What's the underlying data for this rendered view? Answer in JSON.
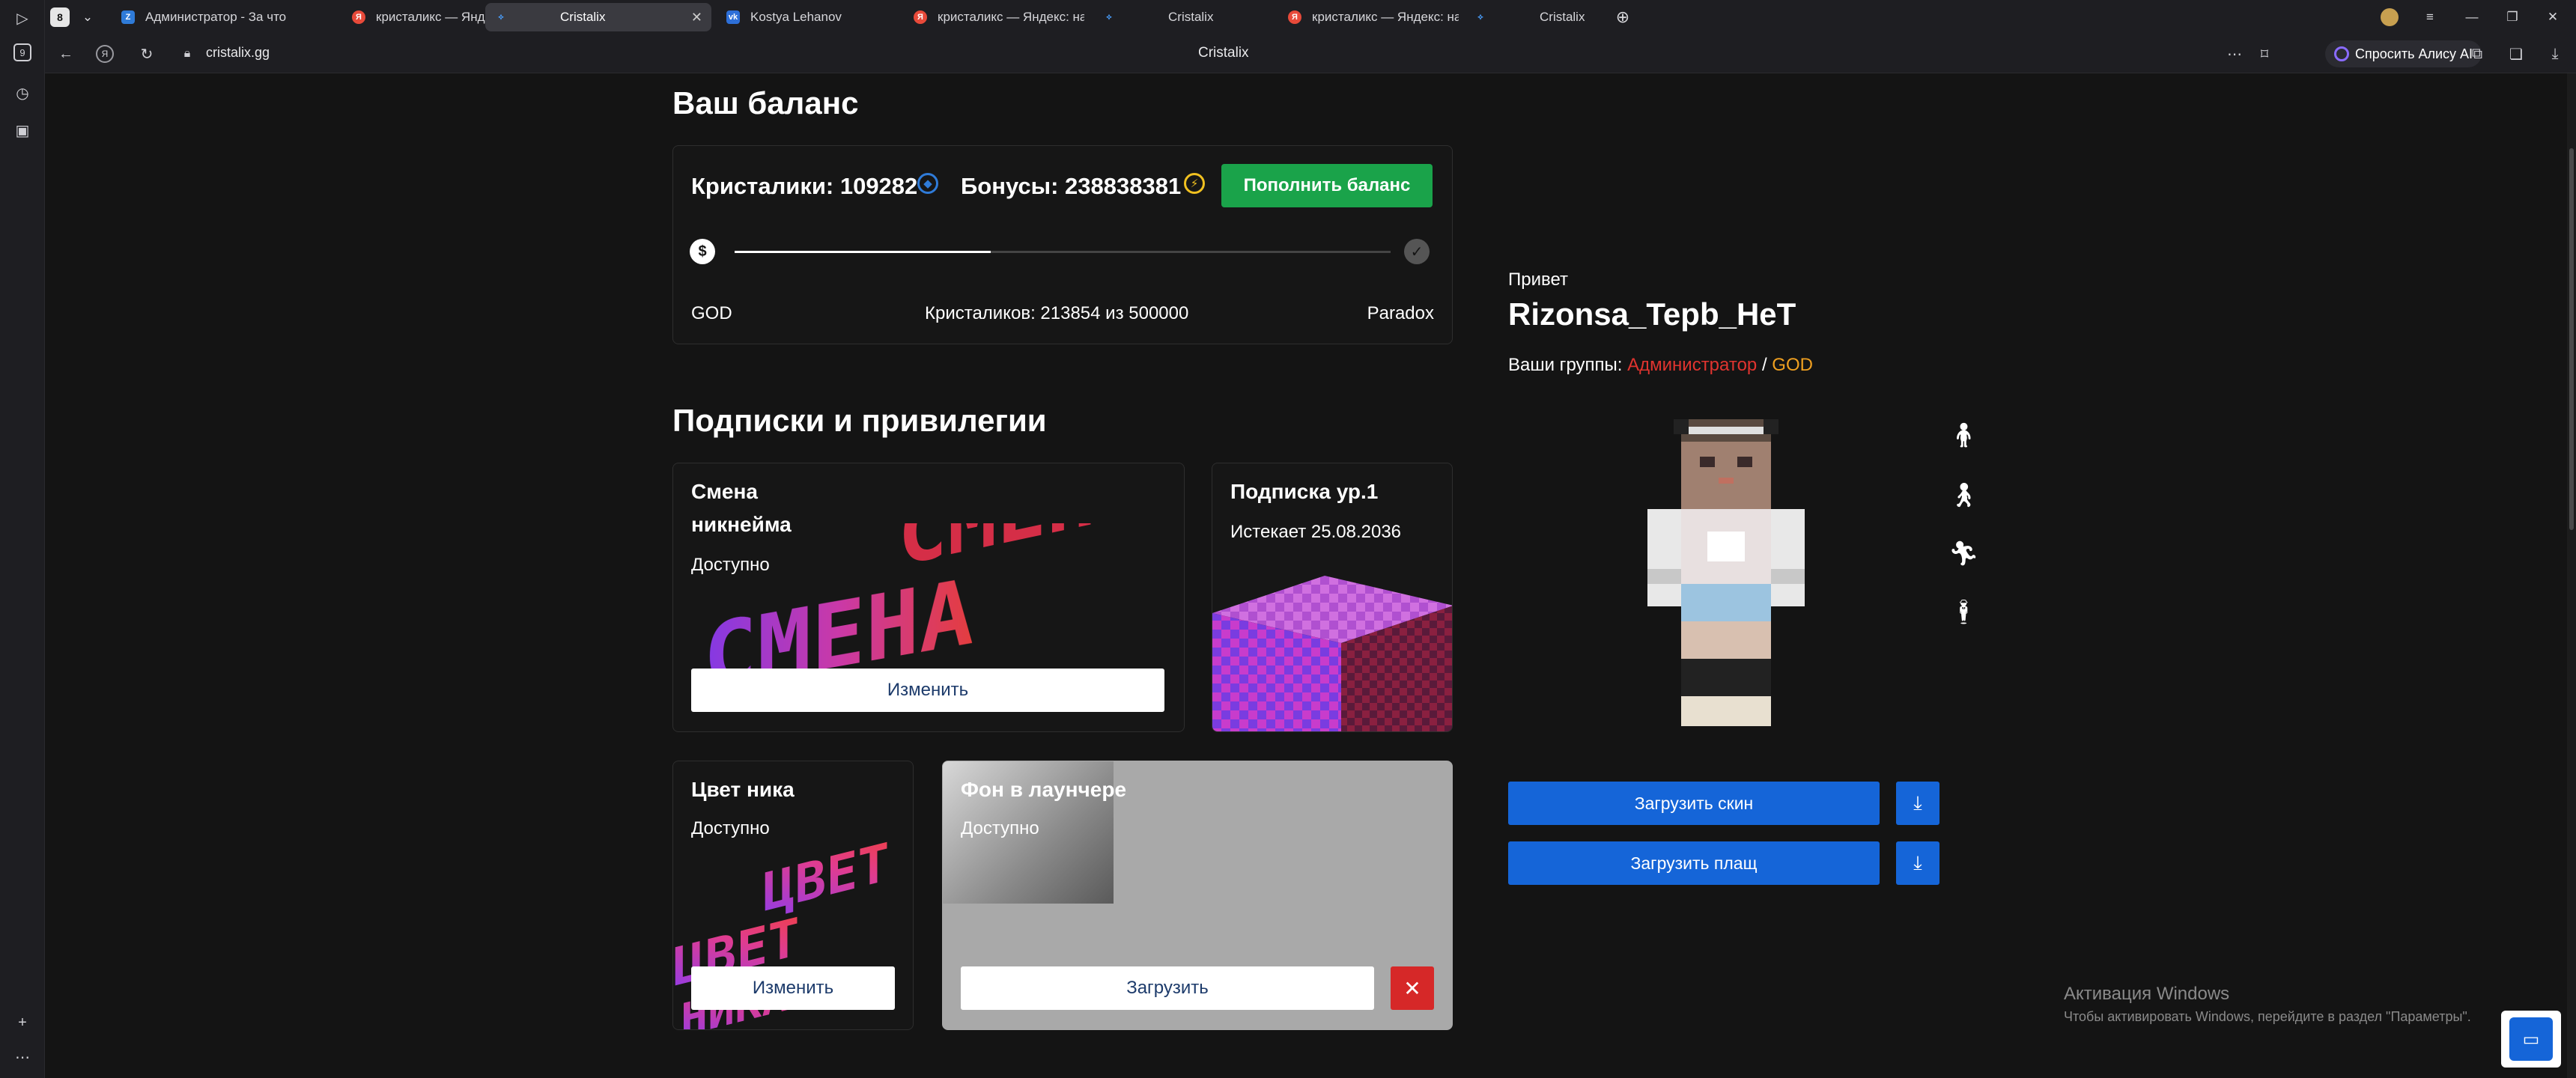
{
  "browser": {
    "tabs": [
      {
        "label": "Администратор - За что",
        "icon": "news-icon"
      },
      {
        "label": "кристаликс — Яндекс: на",
        "icon": "yandex-icon"
      },
      {
        "label": "Cristalix",
        "icon": "cristalix-icon",
        "active": true
      },
      {
        "label": "Kostya Lehanov",
        "icon": "vk-icon"
      },
      {
        "label": "кристаликс — Яндекс: на",
        "icon": "yandex-icon"
      },
      {
        "label": "Cristalix",
        "icon": "cristalix-icon"
      },
      {
        "label": "кристаликс — Яндекс: на",
        "icon": "yandex-icon"
      },
      {
        "label": "Cristalix",
        "icon": "cristalix-icon"
      }
    ],
    "profile_badge": "8",
    "url": "cristalix.gg",
    "page_title": "Cristalix",
    "alisa_label": "Спросить Алису AI",
    "sidebar_badge": "9"
  },
  "balance": {
    "title": "Ваш баланс",
    "crystals_label": "Кристалики: 109282",
    "bonuses_label": "Бонусы: 238838381",
    "topup_button": "Пополнить баланс",
    "progress": 0.39,
    "progress_from": "GOD",
    "progress_text": "Кристаликов: 213854 из 500000",
    "progress_to": "Paradox"
  },
  "subscriptions": {
    "title": "Подписки и привилегии",
    "cards": [
      {
        "title_line1": "Смена",
        "title_line2": "никнейма",
        "status": "Доступно",
        "button": "Изменить"
      },
      {
        "title": "Подписка ур.1",
        "status": "Истекает 25.08.2036"
      },
      {
        "title": "Цвет ника",
        "status": "Доступно",
        "button": "Изменить"
      },
      {
        "title": "Фон в лаунчере",
        "status": "Доступно",
        "button": "Загрузить"
      }
    ]
  },
  "profile": {
    "greeting": "Привет",
    "username": "Rizonsa_Tepb_HeT",
    "groups_label": "Ваши группы:",
    "group1": "Администратор",
    "separator": "/",
    "group2": "GOD",
    "upload_skin": "Загрузить скин",
    "upload_cape": "Загрузить плащ"
  },
  "windows_activation": {
    "title": "Активация Windows",
    "subtitle": "Чтобы активировать Windows, перейдите в раздел \"Параметры\"."
  },
  "colors": {
    "accent_green": "#1aa34a",
    "accent_blue": "#1565d8",
    "admin_red": "#e0342f",
    "god_orange": "#f0a020"
  }
}
